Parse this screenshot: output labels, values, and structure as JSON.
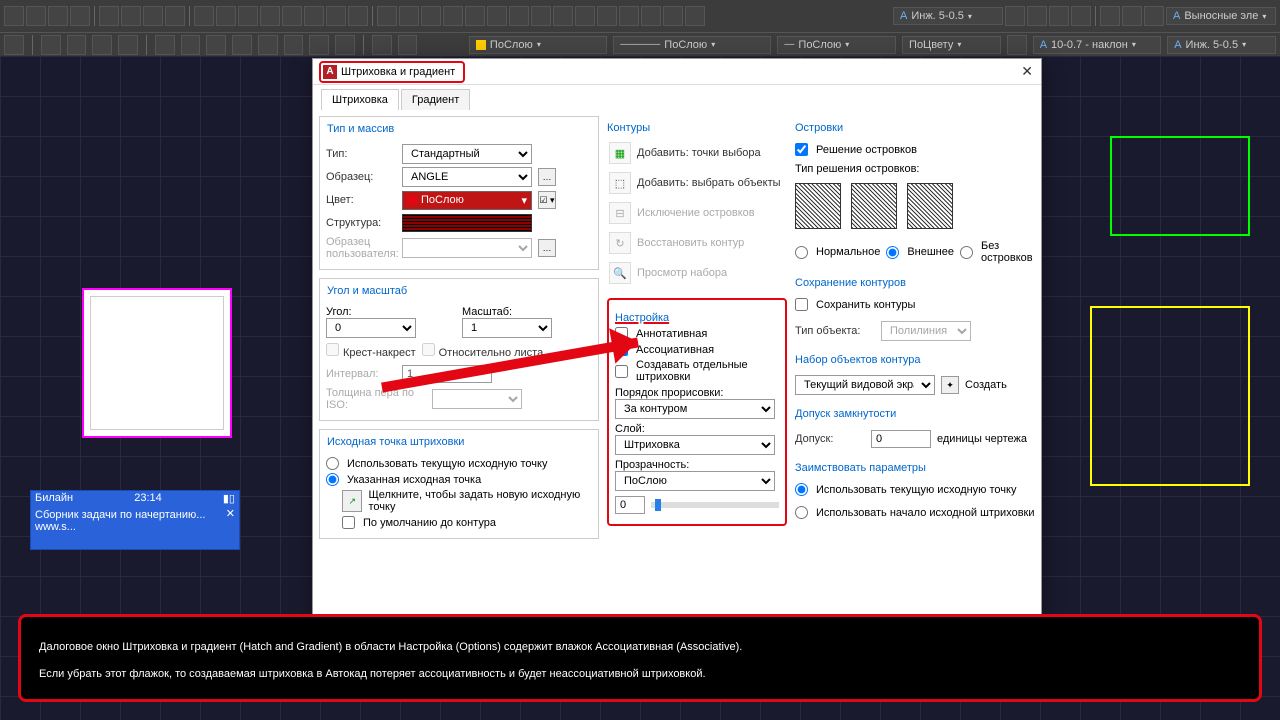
{
  "toolbar": {
    "dropdown1": "Инж. 5-0.5",
    "dropdown2": "Выносные эле"
  },
  "toolbar2": {
    "layer1": "ПоСлою",
    "layer2": "ПоСлою",
    "layer3": "ПоСлою",
    "layer4": "ПоЦвету",
    "style1": "10-0.7 - наклон",
    "style2": "Инж. 5-0.5"
  },
  "dialog": {
    "title": "Штриховка и градиент",
    "tabs": {
      "hatch": "Штриховка",
      "gradient": "Градиент"
    },
    "type_section": {
      "title": "Тип и массив",
      "type_label": "Тип:",
      "type_value": "Стандартный",
      "pattern_label": "Образец:",
      "pattern_value": "ANGLE",
      "color_label": "Цвет:",
      "color_value": "ПоСлою",
      "structure_label": "Структура:",
      "user_pattern_label": "Образец пользователя:"
    },
    "angle_section": {
      "title": "Угол и масштаб",
      "angle_label": "Угол:",
      "angle_value": "0",
      "scale_label": "Масштаб:",
      "scale_value": "1",
      "crosshatch": "Крест-накрест",
      "relative": "Относительно листа",
      "interval_label": "Интервал:",
      "interval_value": "1",
      "iso_label": "Толщина пера по ISO:"
    },
    "origin_section": {
      "title": "Исходная точка штриховки",
      "use_current": "Использовать текущую исходную точку",
      "specified": "Указанная исходная точка",
      "click_hint": "Щелкните, чтобы задать новую исходную точку",
      "default_bounds": "По умолчанию до контура"
    },
    "boundaries": {
      "title": "Контуры",
      "add_pick": "Добавить: точки выбора",
      "add_select": "Добавить: выбрать объекты",
      "remove": "Исключение островков",
      "recreate": "Восстановить контур",
      "view": "Просмотр набора"
    },
    "options": {
      "title": "Настройка",
      "annotative": "Аннотативная",
      "associative": "Ассоциативная",
      "separate": "Создавать отдельные штриховки",
      "draw_order_label": "Порядок прорисовки:",
      "draw_order_value": "За контуром",
      "layer_label": "Слой:",
      "layer_value": "Штриховка",
      "transparency_label": "Прозрачность:",
      "transparency_value": "ПоСлою",
      "transp_num": "0"
    },
    "islands": {
      "title": "Островки",
      "detect": "Решение островков",
      "style_label": "Тип решения островков:",
      "normal": "Нормальное",
      "outer": "Внешнее",
      "ignore": "Без островков"
    },
    "retain": {
      "title": "Сохранение контуров",
      "retain_chk": "Сохранить контуры",
      "objtype_label": "Тип объекта:",
      "objtype_value": "Полилиния"
    },
    "boundary_set": {
      "title": "Набор объектов контура",
      "value": "Текущий видовой экран",
      "create": "Создать"
    },
    "gap": {
      "title": "Допуск замкнутости",
      "label": "Допуск:",
      "value": "0",
      "units": "единицы чертежа"
    },
    "inherit": {
      "title": "Заимствовать параметры",
      "opt1": "Использовать текущую исходную точку",
      "opt2": "Использовать начало исходной штриховки"
    }
  },
  "mobile": {
    "carrier": "Билайн",
    "time": "23:14",
    "line1": "Сборник задачи по начертанию...",
    "line2": "www.s..."
  },
  "caption": {
    "text": "Далоговое окно Штриховка и градиент (Hatch and Gradient) в области Настройка (Options) содержит влажок Ассоциативная (Associative).\nЕсли убрать этот флажок, то создаваемая штриховка в Автокад потеряет ассоциативность и будет неассоциативной штриховкой."
  }
}
